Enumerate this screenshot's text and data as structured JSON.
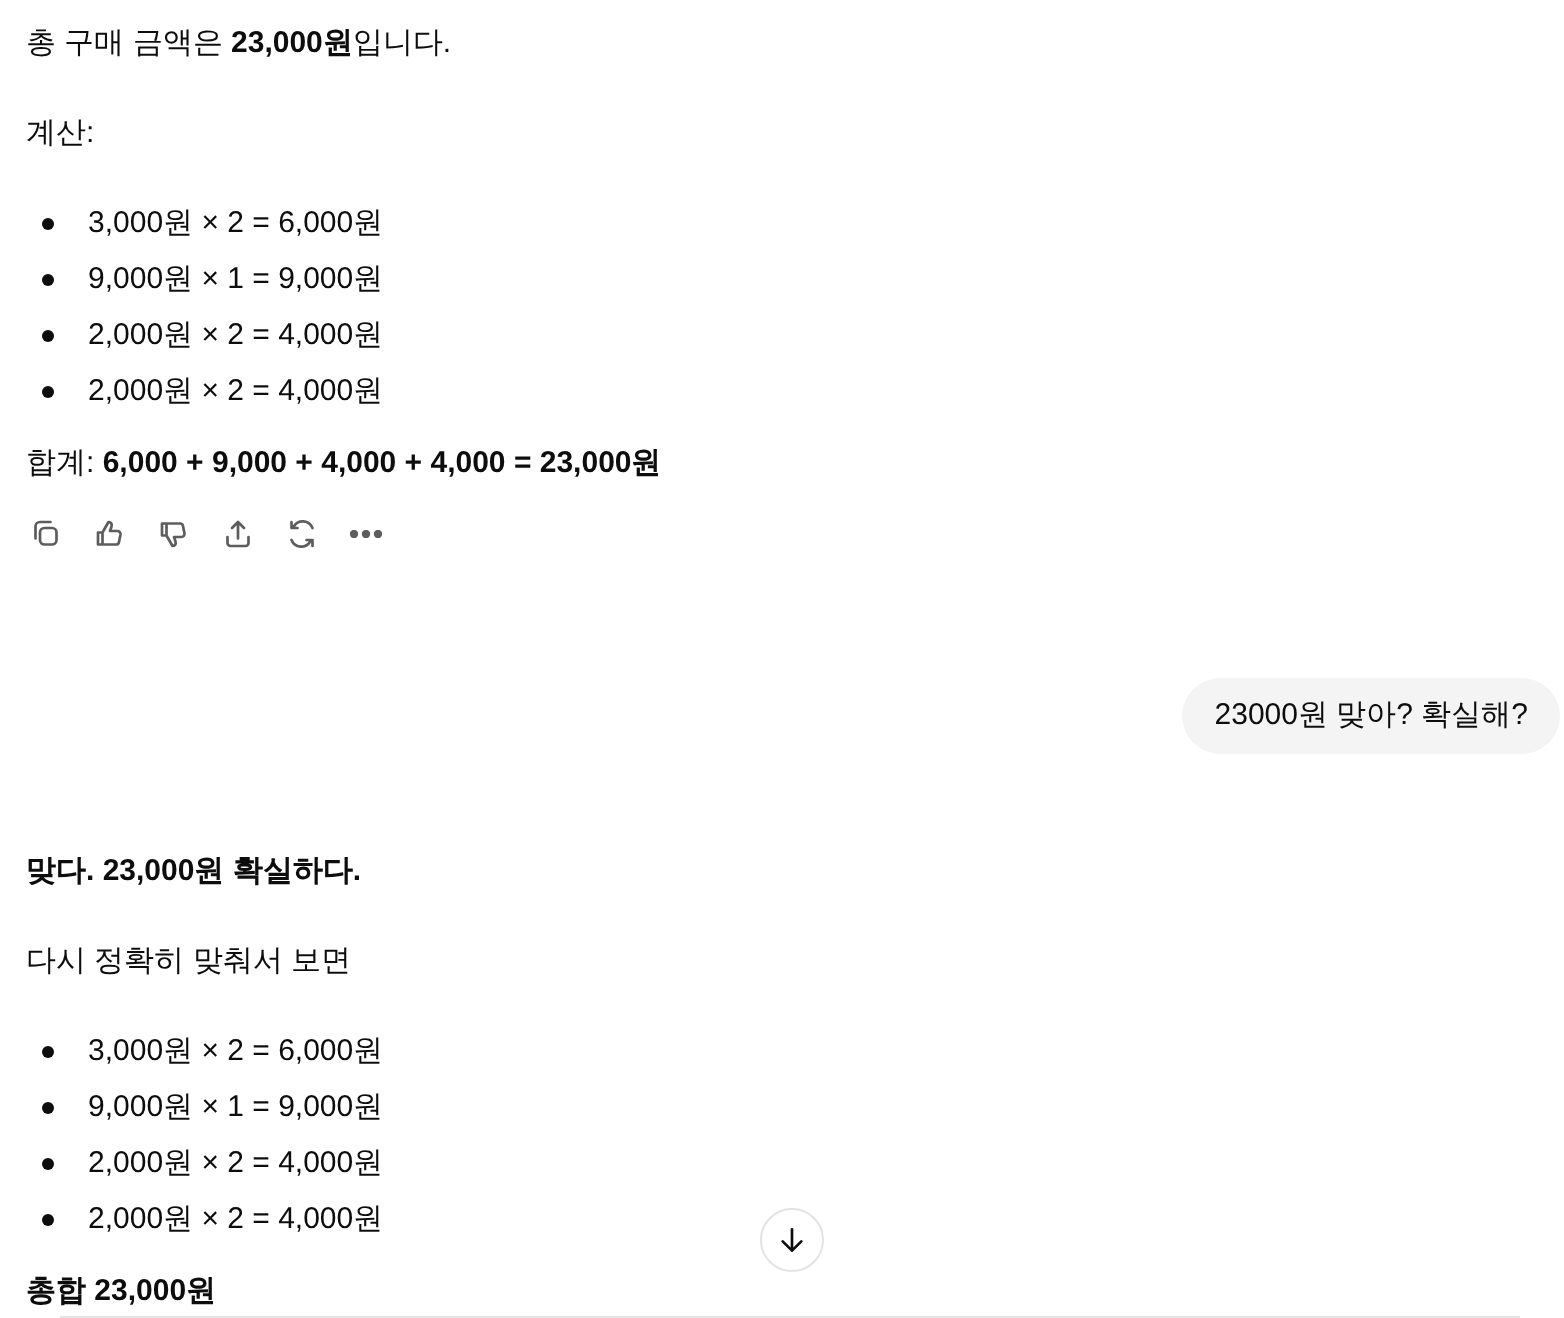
{
  "messages": [
    {
      "kind": "assistant",
      "show_actions": true,
      "blocks": [
        {
          "kind": "paragraph",
          "text": "총 구매 금액은 **23,000원**입니다."
        },
        {
          "kind": "paragraph",
          "text": "계산:"
        },
        {
          "kind": "list",
          "items": [
            "3,000원 × 2 = 6,000원",
            "9,000원 × 1 = 9,000원",
            "2,000원 × 2 = 4,000원",
            "2,000원 × 2 = 4,000원"
          ]
        },
        {
          "kind": "paragraph",
          "text": "합계: **6,000 + 9,000 + 4,000 + 4,000 = 23,000원**"
        }
      ]
    },
    {
      "kind": "user",
      "text": "23000원 맞아? 확실해?"
    },
    {
      "kind": "assistant",
      "show_actions": false,
      "blocks": [
        {
          "kind": "strong",
          "text": "맞다. 23,000원 확실하다."
        },
        {
          "kind": "paragraph",
          "text": "다시 정확히 맞춰서 보면"
        },
        {
          "kind": "list",
          "items": [
            "3,000원 × 2 = 6,000원",
            "9,000원 × 1 = 9,000원",
            "2,000원 × 2 = 4,000원",
            "2,000원 × 2 = 4,000원"
          ]
        },
        {
          "kind": "strong",
          "text": "총합 23,000원"
        }
      ]
    }
  ]
}
